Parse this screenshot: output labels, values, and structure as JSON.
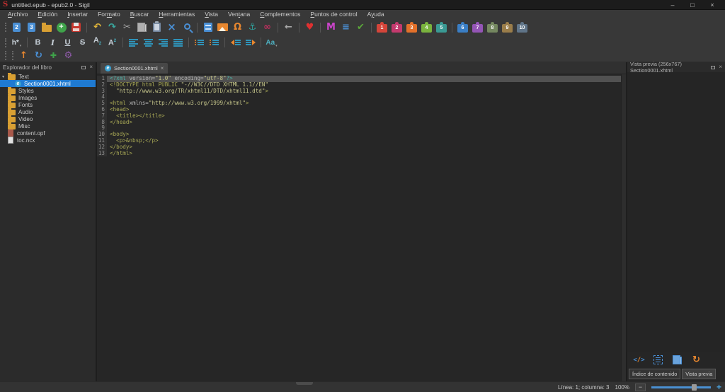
{
  "window": {
    "title": "untitled.epub - epub2.0 - Sigil",
    "logo": "S",
    "minimize": "–",
    "maximize": "□",
    "close": "×"
  },
  "menubar": {
    "items": [
      {
        "label": "Archivo",
        "m": 0
      },
      {
        "label": "Edición",
        "m": 0
      },
      {
        "label": "Insertar",
        "m": 0
      },
      {
        "label": "Formato",
        "m": 3
      },
      {
        "label": "Buscar",
        "m": 0
      },
      {
        "label": "Herramientas",
        "m": 0
      },
      {
        "label": "Vista",
        "m": 0
      },
      {
        "label": "Ventana",
        "m": 3
      },
      {
        "label": "Complementos",
        "m": 0
      },
      {
        "label": "Puntos de control",
        "m": 0
      },
      {
        "label": "Ayuda",
        "m": 1
      }
    ]
  },
  "toolbar_main": [
    {
      "k": "handle",
      "n": "toolbar-drag-handle",
      "i": false
    },
    {
      "k": "doc",
      "t": "2",
      "n": "new-epub2-button",
      "i": true
    },
    {
      "k": "doc",
      "t": "3",
      "n": "new-epub3-button",
      "i": true
    },
    {
      "k": "folder",
      "n": "open-book-button",
      "i": true
    },
    {
      "k": "plus",
      "t": "+",
      "n": "add-existing-files-button",
      "i": true
    },
    {
      "k": "save",
      "n": "save-button",
      "i": true
    },
    {
      "k": "sep",
      "n": "separator",
      "i": false
    },
    {
      "k": "glyph",
      "g": "↶",
      "c": "#e5b83a",
      "n": "undo-button",
      "i": true
    },
    {
      "k": "glyph",
      "g": "↷",
      "c": "#3aa9a0",
      "n": "redo-button",
      "i": true
    },
    {
      "k": "glyph",
      "g": "✂",
      "c": "#a8a8a8",
      "n": "cut-button",
      "i": true
    },
    {
      "k": "copy",
      "n": "copy-button",
      "i": true
    },
    {
      "k": "paste",
      "n": "paste-button",
      "i": true
    },
    {
      "k": "glyph",
      "g": "×",
      "c": "#4a8fd4",
      "fs": "15px",
      "n": "delete-button",
      "i": true
    },
    {
      "k": "search",
      "n": "find-replace-button",
      "i": true
    },
    {
      "k": "sep",
      "n": "separator",
      "i": false
    },
    {
      "k": "split",
      "n": "split-section-button",
      "i": true
    },
    {
      "k": "image",
      "n": "insert-image-button",
      "i": true
    },
    {
      "k": "glyph",
      "g": "Ω",
      "c": "#e8872f",
      "n": "insert-special-character-button",
      "i": true
    },
    {
      "k": "glyph",
      "g": "⚓",
      "c": "#2f9f9a",
      "n": "insert-id-button",
      "i": true
    },
    {
      "k": "glyph",
      "g": "∞",
      "c": "#c22f5f",
      "n": "insert-link-button",
      "i": true
    },
    {
      "k": "sep",
      "n": "separator",
      "i": false
    },
    {
      "k": "glyph",
      "g": "←",
      "c": "#a8a8a8",
      "n": "back-button",
      "i": true
    },
    {
      "k": "sep",
      "n": "separator",
      "i": false
    },
    {
      "k": "glyph",
      "g": "♥",
      "c": "#e03030",
      "n": "donate-heart-button",
      "i": true
    },
    {
      "k": "sep",
      "n": "separator",
      "i": false
    },
    {
      "k": "glyph",
      "g": "M",
      "c": "#cc44cc",
      "n": "metadata-editor-button",
      "i": true
    },
    {
      "k": "glyph",
      "g": "≡",
      "c": "#4a8fd4",
      "n": "generate-toc-button",
      "i": true
    },
    {
      "k": "glyph",
      "g": "✔",
      "c": "#5aa53a",
      "n": "spellcheck-button",
      "i": true
    },
    {
      "k": "sep",
      "n": "separator",
      "i": false
    },
    {
      "k": "puzzle",
      "t": "1",
      "c": "#d4453a",
      "n": "plugin-1-button",
      "i": true
    },
    {
      "k": "puzzle",
      "t": "2",
      "c": "#c43a6e",
      "n": "plugin-2-button",
      "i": true
    },
    {
      "k": "puzzle",
      "t": "3",
      "c": "#e2702a",
      "n": "plugin-3-button",
      "i": true
    },
    {
      "k": "puzzle",
      "t": "4",
      "c": "#7ab33e",
      "n": "plugin-4-button",
      "i": true
    },
    {
      "k": "puzzle",
      "t": "5",
      "c": "#3a9a94",
      "n": "plugin-5-button",
      "i": true
    },
    {
      "k": "sep",
      "n": "separator",
      "i": false
    },
    {
      "k": "puzzle",
      "t": "6",
      "c": "#3a7ec4",
      "n": "plugin-6-button",
      "i": true
    },
    {
      "k": "puzzle",
      "t": "7",
      "c": "#9455b5",
      "n": "plugin-7-button",
      "i": true
    },
    {
      "k": "puzzle",
      "t": "8",
      "c": "#74875f",
      "n": "plugin-8-button",
      "i": true
    },
    {
      "k": "puzzle",
      "t": "9",
      "c": "#9a7d4a",
      "n": "plugin-9-button",
      "i": true
    },
    {
      "k": "puzzle",
      "t": "10",
      "c": "#5f7488",
      "n": "plugin-10-button",
      "i": true
    }
  ],
  "toolbar_format": [
    {
      "k": "handle",
      "n": "toolbar-drag-handle",
      "i": false
    },
    {
      "k": "head",
      "t": "h*",
      "n": "heading-style-button",
      "i": true
    },
    {
      "k": "sep",
      "n": "separator",
      "i": false
    },
    {
      "k": "letter",
      "t": "B",
      "n": "bold-button",
      "i": true
    },
    {
      "k": "letter",
      "t": "I",
      "s": "st-italic",
      "n": "italic-button",
      "i": true
    },
    {
      "k": "letter",
      "t": "U",
      "s": "st-under",
      "n": "underline-button",
      "i": true
    },
    {
      "k": "letter",
      "t": "S",
      "s": "st-strike",
      "n": "strikethrough-button",
      "i": true
    },
    {
      "k": "lettersub",
      "t": "A",
      "x": "2",
      "n": "subscript-button",
      "i": true
    },
    {
      "k": "lettersup",
      "t": "A",
      "x": "2",
      "n": "superscript-button",
      "i": true
    },
    {
      "k": "sep",
      "n": "separator",
      "i": false
    },
    {
      "k": "align",
      "v": "al-l",
      "n": "align-left-button",
      "i": true
    },
    {
      "k": "align",
      "v": "al-c",
      "n": "align-center-button",
      "i": true
    },
    {
      "k": "align",
      "v": "al-r",
      "n": "align-right-button",
      "i": true
    },
    {
      "k": "align",
      "v": "al-j",
      "n": "align-justify-button",
      "i": true
    },
    {
      "k": "sep",
      "n": "separator",
      "i": false
    },
    {
      "k": "ulist",
      "n": "bullet-list-button",
      "i": true
    },
    {
      "k": "ulist",
      "n": "numbered-list-button",
      "i": true
    },
    {
      "k": "sep",
      "n": "separator",
      "i": false
    },
    {
      "k": "outdent",
      "n": "decrease-indent-button",
      "i": true
    },
    {
      "k": "indent",
      "n": "increase-indent-button",
      "i": true
    },
    {
      "k": "sep",
      "n": "separator",
      "i": false
    },
    {
      "k": "case",
      "t": "Aa",
      "n": "change-case-button",
      "i": true
    }
  ],
  "toolbar_tools": [
    {
      "k": "handle",
      "n": "toolbar-drag-handle",
      "i": false
    },
    {
      "k": "handle",
      "n": "toolbar-drag-handle",
      "i": false
    },
    {
      "k": "glyph",
      "g": "↑",
      "c": "#e8872f",
      "fs": "13px",
      "n": "deploy-button",
      "i": true
    },
    {
      "k": "glyph",
      "g": "↻",
      "c": "#4a8fd4",
      "fs": "13px",
      "n": "refresh-button",
      "i": true
    },
    {
      "k": "glyph",
      "g": "✚",
      "c": "#3fa34a",
      "fs": "11px",
      "n": "donate-plus-button",
      "i": true
    },
    {
      "k": "glyph",
      "g": "⚙",
      "c": "#8e5aa8",
      "fs": "13px",
      "n": "settings-gear-button",
      "i": true
    }
  ],
  "sidebar": {
    "title": "Explorador del libro",
    "items": [
      {
        "label": "Text",
        "icon": "folder",
        "level": 0,
        "expanded": true
      },
      {
        "label": "Section0001.xhtml",
        "icon": "html",
        "level": 1,
        "selected": true
      },
      {
        "label": "Styles",
        "icon": "folder",
        "level": 0
      },
      {
        "label": "Images",
        "icon": "folder",
        "level": 0
      },
      {
        "label": "Fonts",
        "icon": "folder",
        "level": 0
      },
      {
        "label": "Audio",
        "icon": "folder",
        "level": 0
      },
      {
        "label": "Video",
        "icon": "folder",
        "level": 0
      },
      {
        "label": "Misc",
        "icon": "folder",
        "level": 0
      },
      {
        "label": "content.opf",
        "icon": "opf",
        "level": 0
      },
      {
        "label": "toc.ncx",
        "icon": "file",
        "level": 0
      }
    ]
  },
  "editor": {
    "tab": {
      "label": "Section0001.xhtml",
      "close": "×"
    },
    "lines": [
      {
        "n": "1",
        "active": true,
        "seg": [
          {
            "c": "pi",
            "t": "<?xml "
          },
          {
            "c": "attr",
            "t": "version="
          },
          {
            "c": "str",
            "t": "\"1.0\""
          },
          {
            "c": "attr",
            "t": " encoding="
          },
          {
            "c": "str",
            "t": "\"utf-8\""
          },
          {
            "c": "pi",
            "t": "?>"
          }
        ]
      },
      {
        "n": "2",
        "seg": [
          {
            "c": "tag",
            "t": "<!DOCTYPE html PUBLIC "
          },
          {
            "c": "str",
            "t": "\"-//W3C//DTD XHTML 1.1//EN\""
          }
        ]
      },
      {
        "n": "3",
        "seg": [
          {
            "c": "str",
            "t": "  \"http://www.w3.org/TR/xhtml11/DTD/xhtml11.dtd\""
          },
          {
            "c": "tag",
            "t": ">"
          }
        ]
      },
      {
        "n": "4",
        "seg": []
      },
      {
        "n": "5",
        "seg": [
          {
            "c": "tag",
            "t": "<html "
          },
          {
            "c": "attr",
            "t": "xmlns="
          },
          {
            "c": "str",
            "t": "\"http://www.w3.org/1999/xhtml\""
          },
          {
            "c": "tag",
            "t": ">"
          }
        ]
      },
      {
        "n": "6",
        "seg": [
          {
            "c": "tag",
            "t": "<head>"
          }
        ]
      },
      {
        "n": "7",
        "seg": [
          {
            "c": "tag",
            "t": "  <title></title>"
          }
        ]
      },
      {
        "n": "8",
        "seg": [
          {
            "c": "tag",
            "t": "</head>"
          }
        ]
      },
      {
        "n": "9",
        "seg": []
      },
      {
        "n": "10",
        "seg": [
          {
            "c": "tag",
            "t": "<body>"
          }
        ]
      },
      {
        "n": "11",
        "seg": [
          {
            "c": "tag",
            "t": "  <p>"
          },
          {
            "c": "ent",
            "t": "&nbsp;"
          },
          {
            "c": "tag",
            "t": "</p>"
          }
        ]
      },
      {
        "n": "12",
        "seg": [
          {
            "c": "tag",
            "t": "</body>"
          }
        ]
      },
      {
        "n": "13",
        "seg": [
          {
            "c": "tag",
            "t": "</html>"
          }
        ]
      }
    ]
  },
  "preview": {
    "title": "Vista previa (256x767) Section0001.xhtml",
    "icons": [
      {
        "k": "code3",
        "n": "code-view-icon",
        "i": true
      },
      {
        "k": "toclist",
        "n": "toc-list-icon",
        "i": true
      },
      {
        "k": "pages",
        "n": "pages-icon",
        "i": true
      },
      {
        "k": "glyph",
        "g": "↻",
        "c": "#e8872f",
        "fs": "13px",
        "n": "refresh-preview-icon",
        "i": true
      }
    ],
    "tabs": [
      {
        "label": "Índice de contenido",
        "active": false
      },
      {
        "label": "Vista previa",
        "active": true
      }
    ]
  },
  "statusbar": {
    "position": "Línea: 1; columna: 3",
    "zoom_level": "100%",
    "zoom_out": "−",
    "zoom_in": "+",
    "slider_pct": 68
  }
}
